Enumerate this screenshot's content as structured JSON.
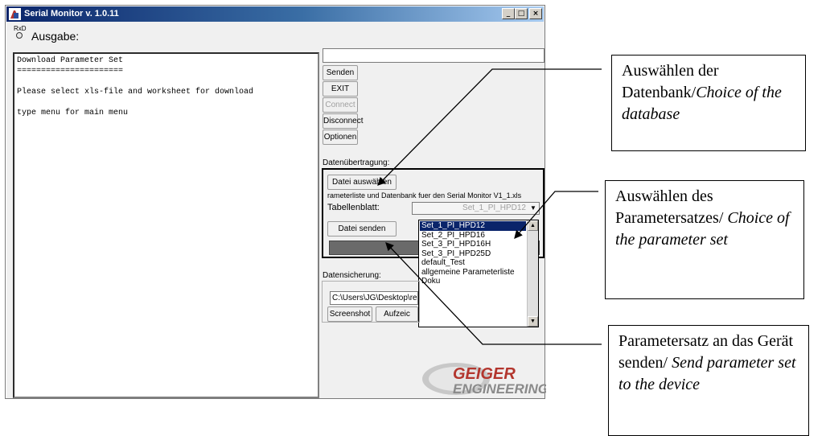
{
  "window": {
    "title": "Serial Monitor v. 1.0.11",
    "min_symbol": "_",
    "max_symbol": "□",
    "close_symbol": "×"
  },
  "rxd": {
    "label": "RxD"
  },
  "output": {
    "label": "Ausgabe:",
    "text": "Download Parameter Set\n======================\n\nPlease select xls-file and worksheet for download\n\ntype menu for main menu"
  },
  "command_input": {
    "value": ""
  },
  "buttons": {
    "senden": "Senden",
    "exit": "EXIT",
    "connect": "Connect",
    "disconnect": "Disconnect",
    "optionen": "Optionen"
  },
  "transfer": {
    "label": "Datenübertragung:",
    "choose_file": "Datei auswählen",
    "filename": "rameterliste und Datenbank fuer den Serial Monitor V1_1.xls",
    "sheet_label": "Tabellenblatt:",
    "sheet_value": "Set_1_PI_HPD12",
    "send_file": "Datei senden",
    "sheets": [
      "Set_1_PI_HPD12",
      "Set_2_PI_HPD16",
      "Set_3_PI_HPD16H",
      "Set_3_PI_HPD25D",
      "default_Test",
      "allgemeine Parameterliste",
      "Doku"
    ],
    "selected_index": 0
  },
  "backup": {
    "label": "Datensicherung:",
    "path": "C:\\Users\\JG\\Desktop\\rec",
    "screenshot": "Screenshot",
    "record": "Aufzeic"
  },
  "logo": {
    "line1": "GEIGER",
    "line2": "ENGINEERING"
  },
  "annotations": [
    {
      "plain": "Auswählen der Datenbank/",
      "italic": "Choice of the database"
    },
    {
      "plain": "Auswählen des Parametersatzes/ ",
      "italic": "Choice of the parameter set"
    },
    {
      "plain": "Parametersatz an das Gerät senden/ ",
      "italic": "Send parameter set to the device"
    }
  ],
  "colors": {
    "title_bar": "#0a246a",
    "selection": "#0a246a",
    "logo_red": "#b3362e",
    "logo_gray": "#8a8a8a"
  }
}
